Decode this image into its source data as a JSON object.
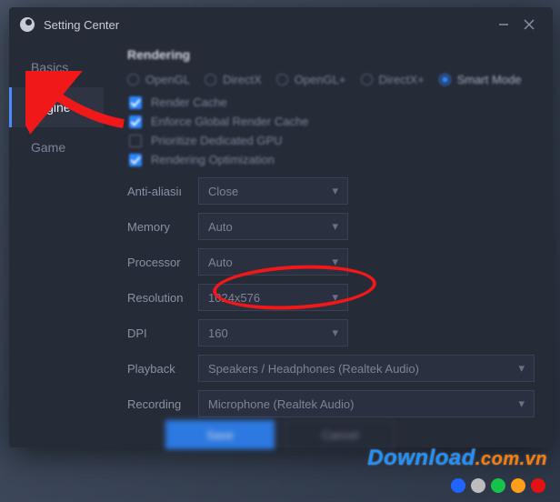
{
  "window": {
    "title": "Setting Center"
  },
  "sidebar": {
    "items": [
      {
        "label": "Basics"
      },
      {
        "label": "Engine"
      },
      {
        "label": "Game"
      }
    ],
    "active_index": 1
  },
  "rendering": {
    "title": "Rendering",
    "engines": [
      {
        "label": "OpenGL",
        "checked": false
      },
      {
        "label": "DirectX",
        "checked": false
      },
      {
        "label": "OpenGL+",
        "checked": false
      },
      {
        "label": "DirectX+",
        "checked": false
      },
      {
        "label": "Smart Mode",
        "checked": true
      }
    ],
    "options": [
      {
        "label": "Render Cache",
        "checked": true
      },
      {
        "label": "Enforce Global Render Cache",
        "checked": true
      },
      {
        "label": "Prioritize Dedicated GPU",
        "checked": false
      },
      {
        "label": "Rendering Optimization",
        "checked": true
      }
    ]
  },
  "fields": {
    "anti_aliasing": {
      "label": "Anti-aliasiı",
      "value": "Close"
    },
    "memory": {
      "label": "Memory",
      "value": "Auto"
    },
    "processor": {
      "label": "Processor",
      "value": "Auto"
    },
    "resolution": {
      "label": "Resolution",
      "value": "1024x576"
    },
    "dpi": {
      "label": "DPI",
      "value": "160"
    },
    "playback": {
      "label": "Playback",
      "value": "Speakers / Headphones (Realtek Audio)"
    },
    "recording": {
      "label": "Recording",
      "value": "Microphone (Realtek Audio)"
    }
  },
  "buttons": {
    "save": "Save",
    "cancel": "Cancel"
  },
  "watermark": {
    "main": "Download",
    "suffix": ".com.vn"
  },
  "dot_colors": [
    "#1e66ff",
    "#bdbdbd",
    "#17c24a",
    "#ff9f1a",
    "#e41212"
  ]
}
